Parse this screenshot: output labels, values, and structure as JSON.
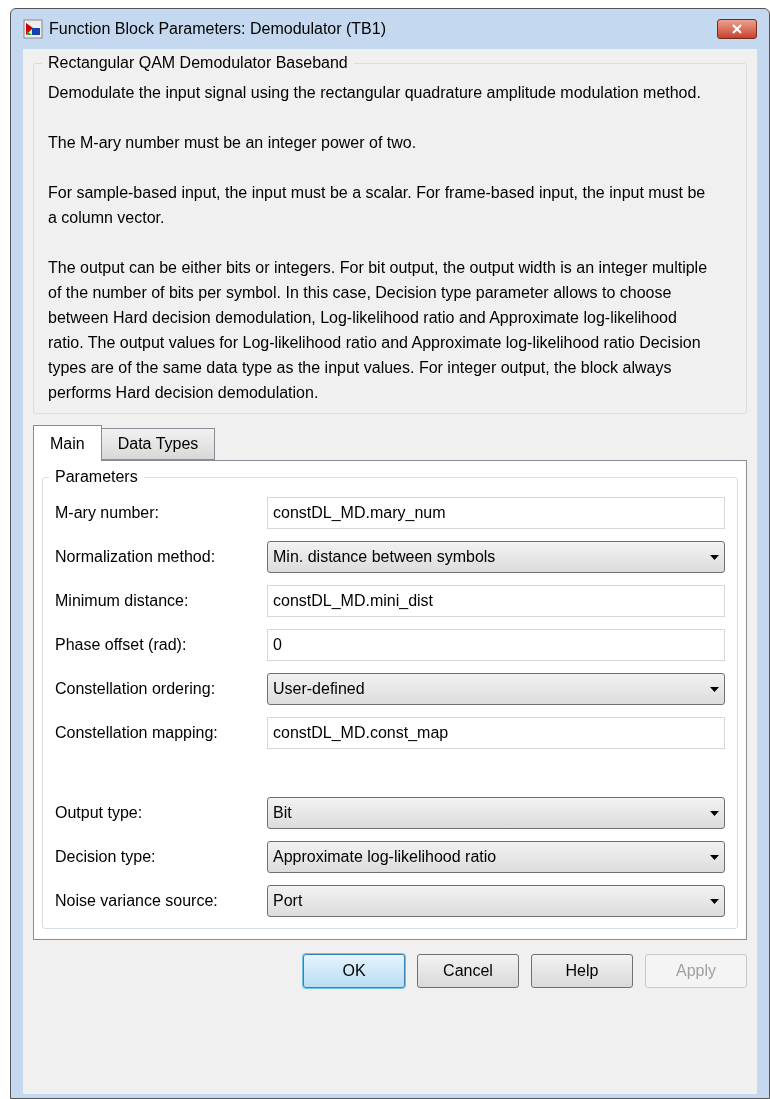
{
  "window": {
    "title": "Function Block Parameters: Demodulator (TB1)"
  },
  "description": {
    "title": "Rectangular QAM Demodulator Baseband",
    "paragraphs": [
      "Demodulate the input signal using the rectangular quadrature amplitude modulation method.",
      "The M-ary number must be an integer power of two.",
      "For sample-based input, the input must be a scalar. For frame-based input, the input must be a column vector.",
      "The output can be either bits or integers. For bit output, the output width is an integer multiple of the number of bits per symbol. In this case, Decision type parameter allows to choose between Hard decision demodulation, Log-likelihood ratio and Approximate log-likelihood ratio. The output values for Log-likelihood ratio and Approximate log-likelihood ratio Decision types are of the same data type as the input values. For integer output, the block always performs Hard decision demodulation."
    ]
  },
  "tabs": [
    {
      "label": "Main",
      "selected": true
    },
    {
      "label": "Data Types",
      "selected": false
    }
  ],
  "parameters": {
    "title": "Parameters",
    "fields": [
      {
        "label": "M-ary number:",
        "kind": "text",
        "value": "constDL_MD.mary_num"
      },
      {
        "label": "Normalization method:",
        "kind": "dropdown",
        "value": "Min. distance between symbols"
      },
      {
        "label": "Minimum distance:",
        "kind": "text",
        "value": "constDL_MD.mini_dist"
      },
      {
        "label": "Phase offset (rad):",
        "kind": "text",
        "value": "0"
      },
      {
        "label": "Constellation ordering:",
        "kind": "dropdown",
        "value": "User-defined"
      },
      {
        "label": "Constellation mapping:",
        "kind": "text",
        "value": "constDL_MD.const_map"
      }
    ],
    "output_fields": [
      {
        "label": "Output type:",
        "kind": "dropdown",
        "value": "Bit"
      },
      {
        "label": "Decision type:",
        "kind": "dropdown",
        "value": "Approximate log-likelihood ratio"
      },
      {
        "label": "Noise variance source:",
        "kind": "dropdown",
        "value": "Port"
      }
    ]
  },
  "buttons": [
    {
      "label": "OK",
      "default": true,
      "disabled": false
    },
    {
      "label": "Cancel",
      "default": false,
      "disabled": false
    },
    {
      "label": "Help",
      "default": false,
      "disabled": false
    },
    {
      "label": "Apply",
      "default": false,
      "disabled": true
    }
  ]
}
